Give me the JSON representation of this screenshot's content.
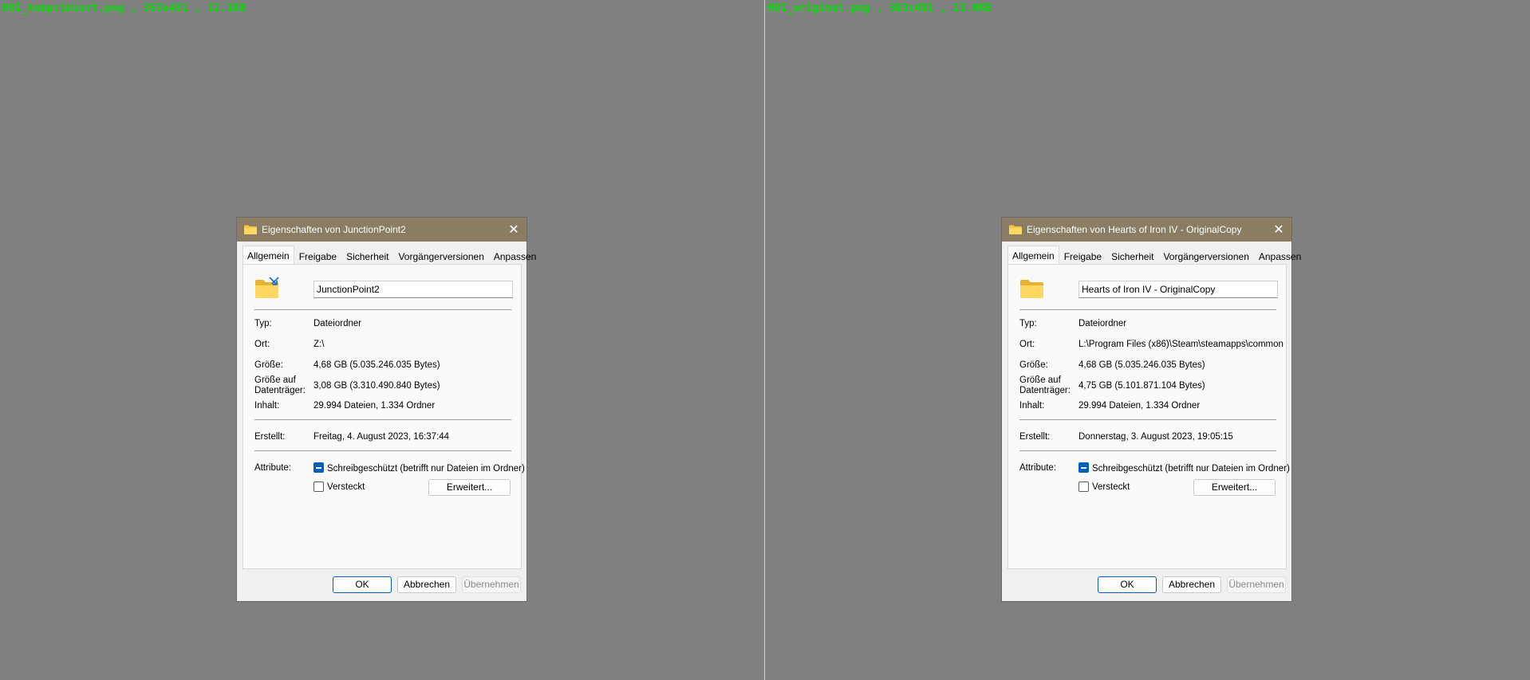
{
  "panes": [
    {
      "caption": "HOI_komprimiert.png , 363x481 , 12.1KB",
      "dialog": {
        "title": "Eigenschaften von JunctionPoint2",
        "close_label": "✕",
        "tabs": [
          "Allgemein",
          "Freigabe",
          "Sicherheit",
          "Vorgängerversionen",
          "Anpassen"
        ],
        "active_tab": "Allgemein",
        "folder_icon": "junction-folder-icon",
        "name": "JunctionPoint2",
        "type_label": "Typ:",
        "type_value": "Dateiordner",
        "location_label": "Ort:",
        "location_value": "Z:\\",
        "size_label": "Größe:",
        "size_value": "4,68 GB (5.035.246.035 Bytes)",
        "disk_size_label_1": "Größe auf",
        "disk_size_label_2": "Datenträger:",
        "disk_size_value": "3,08 GB (3.310.490.840 Bytes)",
        "contents_label": "Inhalt:",
        "contents_value": "29.994 Dateien, 1.334 Ordner",
        "created_label": "Erstellt:",
        "created_value": "Freitag, 4. August 2023, 16:37:44",
        "attributes_label": "Attribute:",
        "readonly_label": "Schreibgeschützt (betrifft nur Dateien im Ordner)",
        "readonly_state": "indeterminate",
        "hidden_label": "Versteckt",
        "hidden_checked": false,
        "advanced_label": "Erweitert...",
        "ok_label": "OK",
        "cancel_label": "Abbrechen",
        "apply_label": "Übernehmen"
      }
    },
    {
      "caption": "HOI_original.png , 363x481 , 13.0KB",
      "dialog": {
        "title": "Eigenschaften von Hearts of Iron IV - OriginalCopy",
        "close_label": "✕",
        "tabs": [
          "Allgemein",
          "Freigabe",
          "Sicherheit",
          "Vorgängerversionen",
          "Anpassen"
        ],
        "active_tab": "Allgemein",
        "folder_icon": "folder-icon",
        "name": "Hearts of Iron IV - OriginalCopy",
        "type_label": "Typ:",
        "type_value": "Dateiordner",
        "location_label": "Ort:",
        "location_value": "L:\\Program Files (x86)\\Steam\\steamapps\\common",
        "size_label": "Größe:",
        "size_value": "4,68 GB (5.035.246.035 Bytes)",
        "disk_size_label_1": "Größe auf",
        "disk_size_label_2": "Datenträger:",
        "disk_size_value": "4,75 GB (5.101.871.104 Bytes)",
        "contents_label": "Inhalt:",
        "contents_value": "29.994 Dateien, 1.334 Ordner",
        "created_label": "Erstellt:",
        "created_value": "Donnerstag, 3. August 2023, 19:05:15",
        "attributes_label": "Attribute:",
        "readonly_label": "Schreibgeschützt (betrifft nur Dateien im Ordner)",
        "readonly_state": "indeterminate",
        "hidden_label": "Versteckt",
        "hidden_checked": false,
        "advanced_label": "Erweitert...",
        "ok_label": "OK",
        "cancel_label": "Abbrechen",
        "apply_label": "Übernehmen"
      }
    }
  ],
  "colors": {
    "background": "#808080",
    "titlebar": "#8b7d64",
    "caption_text": "#00e000",
    "accent": "#005fb8",
    "folder_yellow": "#f4c542"
  }
}
